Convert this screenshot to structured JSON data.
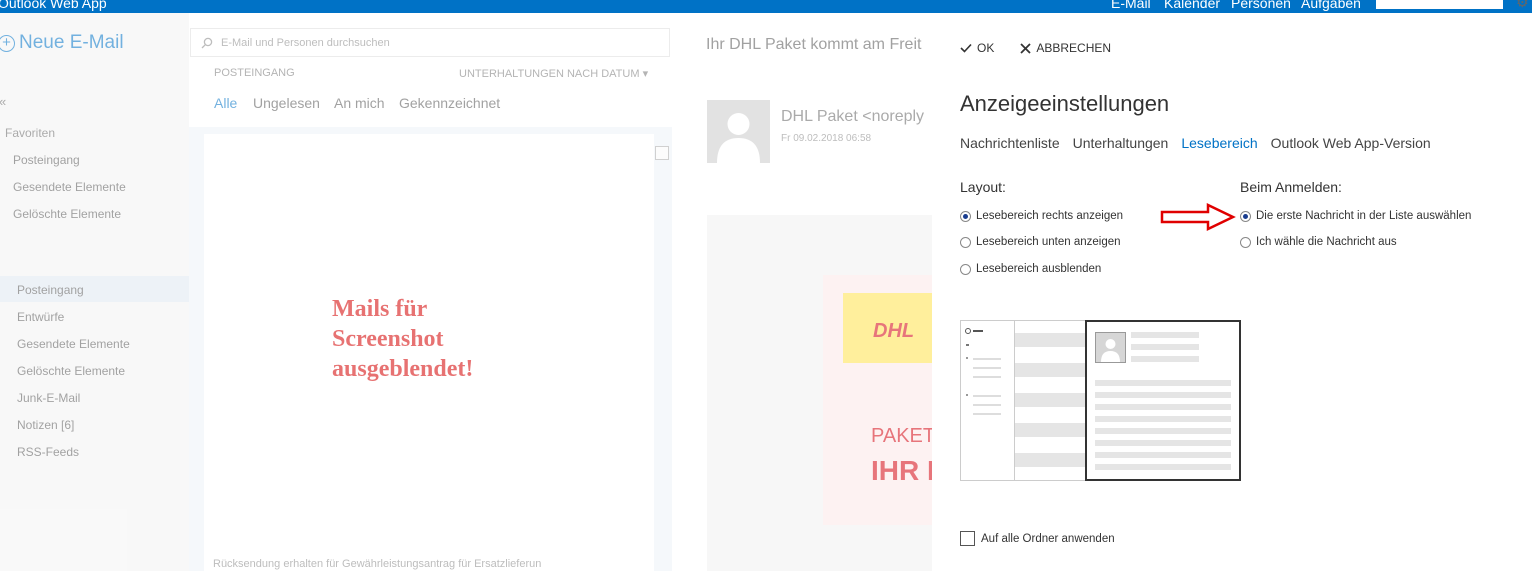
{
  "topbar": {
    "app_title": "Outlook Web App",
    "nav": [
      "E-Mail",
      "Kalender",
      "Personen",
      "Aufgaben"
    ]
  },
  "left_pane": {
    "new_mail_label": "Neue E-Mail",
    "favorites_heading": "Favoriten",
    "favorites": [
      "Posteingang",
      "Gesendete Elemente",
      "Gelöschte Elemente"
    ],
    "folders": [
      "Posteingang",
      "Entwürfe",
      "Gesendete Elemente",
      "Gelöschte Elemente",
      "Junk-E-Mail",
      "Notizen [6]",
      "RSS-Feeds"
    ]
  },
  "list_pane": {
    "search_placeholder": "E-Mail und Personen durchsuchen",
    "folder_heading": "POSTEINGANG",
    "sort_label": "UNTERHALTUNGEN NACH DATUM",
    "filters": [
      "Alle",
      "Ungelesen",
      "An mich",
      "Gekennzeichnet"
    ],
    "active_filter": "Alle",
    "hidden_note_lines": [
      "Mails für",
      "Screenshot",
      "ausgeblendet!"
    ],
    "footer_text": "Rücksendung erhalten für Gewährleistungsantrag für Ersatzlieferun"
  },
  "read_pane": {
    "subject": "Ihr DHL Paket kommt am Freit",
    "sender": "DHL Paket <noreply",
    "date": "Fr 09.02.2018 06:58",
    "banner_logo": "DHL",
    "banner_line1": "PAKETA",
    "banner_line2": "IHR P"
  },
  "settings": {
    "ok_label": "OK",
    "cancel_label": "ABBRECHEN",
    "title": "Anzeigeeinstellungen",
    "tabs": [
      "Nachrichtenliste",
      "Unterhaltungen",
      "Lesebereich",
      "Outlook Web App-Version"
    ],
    "active_tab": "Lesebereich",
    "layout_heading": "Layout:",
    "layout_options": [
      "Lesebereich rechts anzeigen",
      "Lesebereich unten anzeigen",
      "Lesebereich ausblenden"
    ],
    "layout_selected": 0,
    "login_heading": "Beim Anmelden:",
    "login_options": [
      "Die erste Nachricht in der Liste auswählen",
      "Ich wähle die Nachricht aus"
    ],
    "login_selected": 0,
    "apply_all_label": "Auf alle Ordner anwenden",
    "apply_all_checked": false
  },
  "colors": {
    "accent": "#0072c6",
    "annotation_red": "#d40000",
    "dhl_red": "#d40511",
    "dhl_yellow": "#ffe34d"
  }
}
